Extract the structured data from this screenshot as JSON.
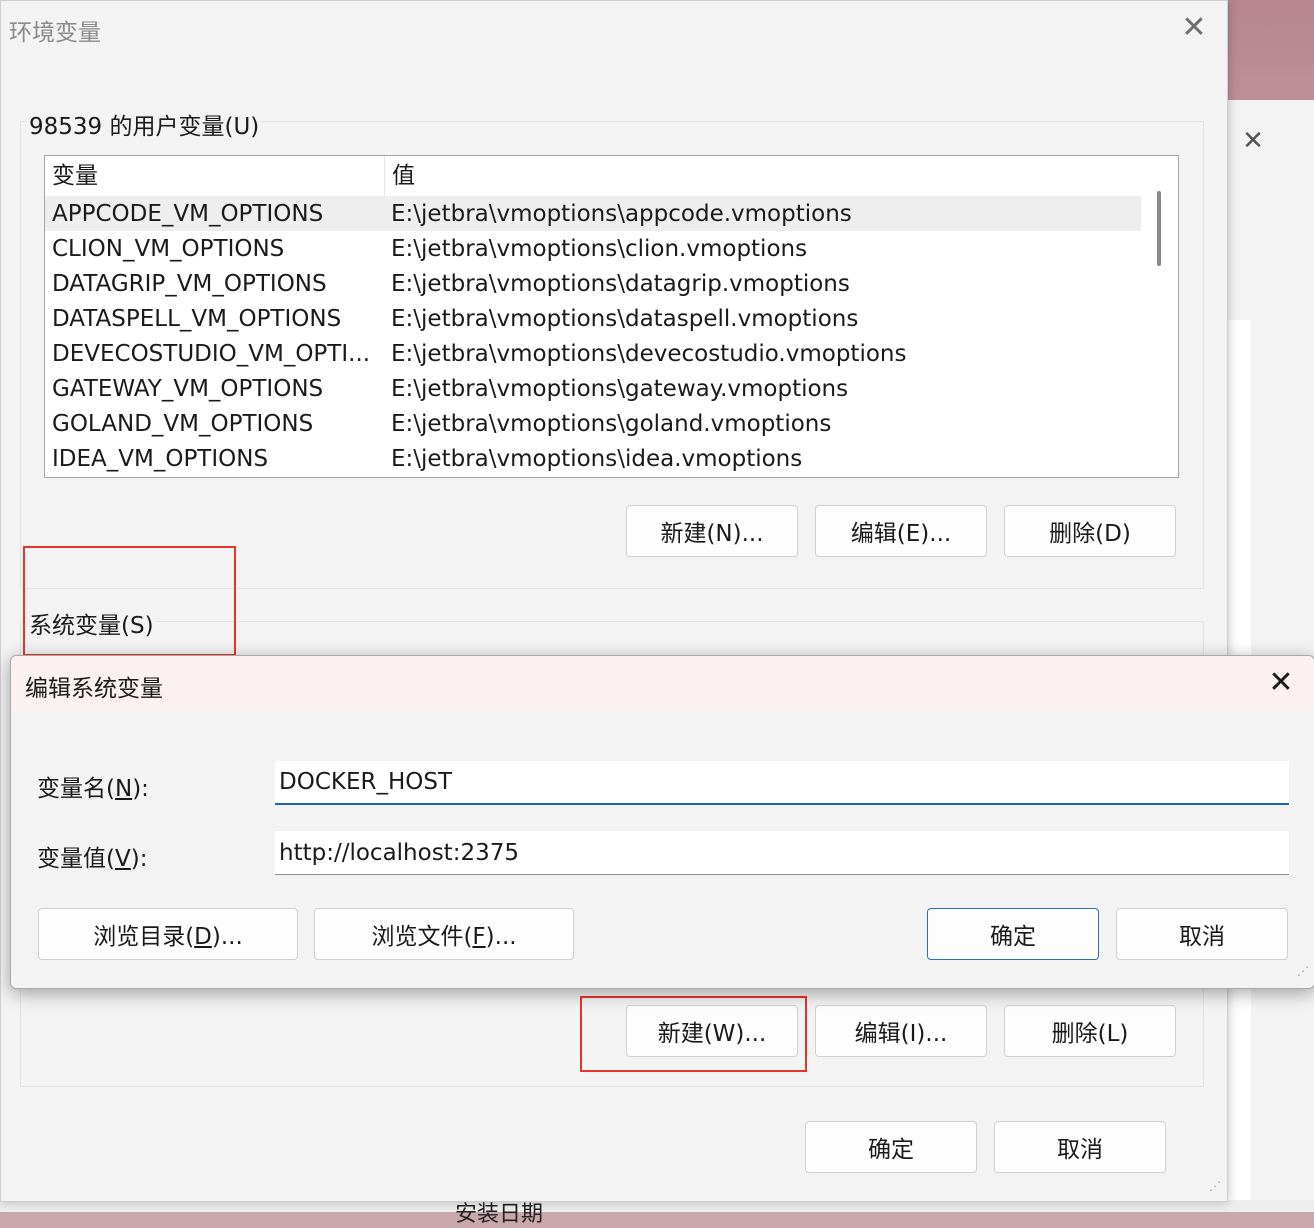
{
  "background": {
    "bottom_text": "安装日期"
  },
  "env_window": {
    "title": "环境变量",
    "user_vars": {
      "group_label": "98539 的用户变量(U)",
      "columns": [
        "变量",
        "值"
      ],
      "rows": [
        {
          "name": "APPCODE_VM_OPTIONS",
          "value": "E:\\jetbra\\vmoptions\\appcode.vmoptions"
        },
        {
          "name": "CLION_VM_OPTIONS",
          "value": "E:\\jetbra\\vmoptions\\clion.vmoptions"
        },
        {
          "name": "DATAGRIP_VM_OPTIONS",
          "value": "E:\\jetbra\\vmoptions\\datagrip.vmoptions"
        },
        {
          "name": "DATASPELL_VM_OPTIONS",
          "value": "E:\\jetbra\\vmoptions\\dataspell.vmoptions"
        },
        {
          "name": "DEVECOSTUDIO_VM_OPTI...",
          "value": "E:\\jetbra\\vmoptions\\devecostudio.vmoptions"
        },
        {
          "name": "GATEWAY_VM_OPTIONS",
          "value": "E:\\jetbra\\vmoptions\\gateway.vmoptions"
        },
        {
          "name": "GOLAND_VM_OPTIONS",
          "value": "E:\\jetbra\\vmoptions\\goland.vmoptions"
        },
        {
          "name": "IDEA_VM_OPTIONS",
          "value": "E:\\jetbra\\vmoptions\\idea.vmoptions"
        }
      ],
      "buttons": {
        "new": "新建(N)...",
        "edit": "编辑(E)...",
        "delete": "删除(D)"
      }
    },
    "system_vars": {
      "group_label": "系统变量(S)",
      "buttons": {
        "new": "新建(W)...",
        "edit": "编辑(I)...",
        "delete": "删除(L)"
      }
    },
    "footer": {
      "ok": "确定",
      "cancel": "取消"
    }
  },
  "edit_dialog": {
    "title": "编辑系统变量",
    "name_label_pre": "变量名(",
    "name_label_key": "N",
    "name_label_post": "):",
    "value_label_pre": "变量值(",
    "value_label_key": "V",
    "value_label_post": "):",
    "name_value": "DOCKER_HOST",
    "value_value": "http://localhost:2375",
    "buttons": {
      "browse_dir_pre": "浏览目录(",
      "browse_dir_key": "D",
      "browse_dir_post": ")...",
      "browse_file_pre": "浏览文件(",
      "browse_file_key": "F",
      "browse_file_post": ")...",
      "ok": "确定",
      "cancel": "取消"
    }
  },
  "highlight_color": "#e8322e",
  "accent_color": "#1f63b5"
}
